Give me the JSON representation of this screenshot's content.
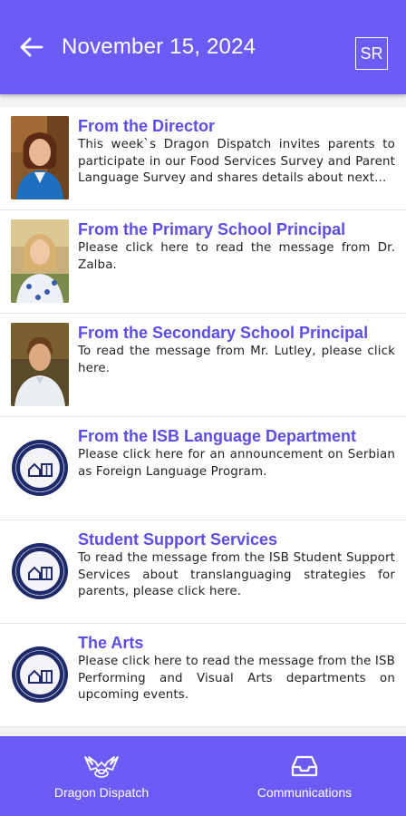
{
  "header": {
    "title": "November 15, 2024",
    "avatar_initials": "SR",
    "back_icon": "arrow-left-icon"
  },
  "items": [
    {
      "title": "From the Director",
      "description": "This week`s Dragon Dispatch invites parents to participate in our Food Services Survey and Parent Language Survey and shares details about next..."
    },
    {
      "title": "From the Primary School Principal",
      "description": "Please click here to read the message from Dr. Zalba."
    },
    {
      "title": "From the Secondary School Principal",
      "description": "To read the message from Mr. Lutley, please click here."
    },
    {
      "title": "From the ISB Language Department",
      "description": "Please click here for an announcement on Serbian as Foreign Language Program."
    },
    {
      "title": "Student Support Services",
      "description": "To read the message from the ISB Student Support Services about translanguaging strategies for parents, please click here."
    },
    {
      "title": "The Arts",
      "description": "Please click here to read the message from the ISB Performing and Visual Arts departments on upcoming events."
    }
  ],
  "bottom_nav": [
    {
      "label": "Dragon Dispatch",
      "icon": "dragon-icon"
    },
    {
      "label": "Communications",
      "icon": "inbox-icon"
    }
  ],
  "colors": {
    "primary": "#6a5cf5",
    "title_text": "#5b4ee8",
    "background": "#f3f3f5"
  }
}
